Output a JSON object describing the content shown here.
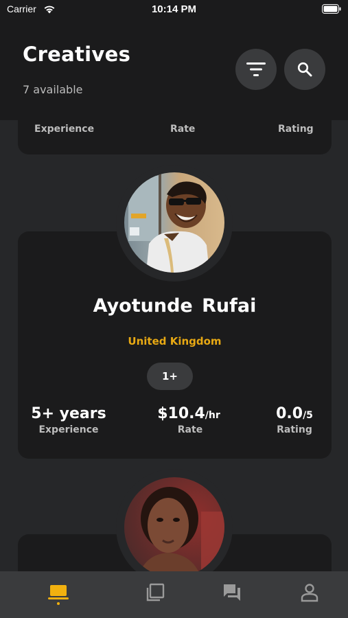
{
  "status_bar": {
    "carrier": "Carrier",
    "time": "10:14 PM"
  },
  "header": {
    "title": "Creatives",
    "subtitle": "7 available",
    "filter_icon": "filter-icon",
    "search_icon": "search-icon"
  },
  "cards": [
    {
      "stats": [
        {
          "label": "Experience"
        },
        {
          "label": "Rate"
        },
        {
          "label": "Rating"
        }
      ]
    },
    {
      "name": "Ayotunde Rufai",
      "country": "United Kingdom",
      "badge": "1+",
      "stats": [
        {
          "value": "5+ years",
          "unit": "",
          "label": "Experience"
        },
        {
          "value": "$10.4",
          "unit": "/hr",
          "label": "Rate"
        },
        {
          "value": "0.0",
          "unit": "/5",
          "label": "Rating"
        }
      ]
    }
  ],
  "tab_bar": {
    "tabs": [
      {
        "icon": "laptop-icon",
        "active": true
      },
      {
        "icon": "collections-icon",
        "active": false
      },
      {
        "icon": "chat-icon",
        "active": false
      },
      {
        "icon": "profile-icon",
        "active": false
      }
    ]
  },
  "colors": {
    "background": "#262729",
    "card": "#1b1b1c",
    "accent": "#f2b10f",
    "country": "#e8a913",
    "button": "#3a3b3d"
  }
}
